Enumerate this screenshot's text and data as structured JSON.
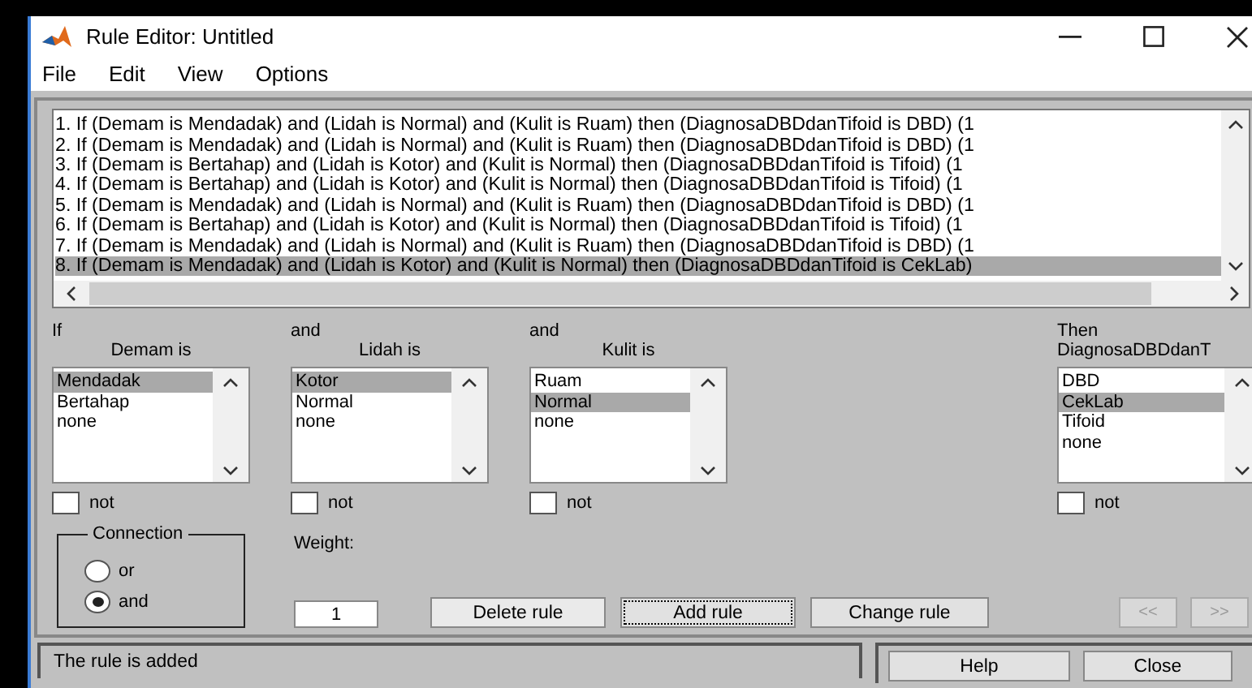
{
  "window": {
    "title": "Rule Editor: Untitled"
  },
  "menu": [
    "File",
    "Edit",
    "View",
    "Options"
  ],
  "rules": [
    {
      "text": "1. If (Demam is Mendadak) and (Lidah is Normal) and (Kulit is Ruam) then (DiagnosaDBDdanTifoid is DBD) (1",
      "selected": false
    },
    {
      "text": "2. If (Demam is Mendadak) and (Lidah is Normal) and (Kulit is Ruam) then (DiagnosaDBDdanTifoid is DBD) (1",
      "selected": false
    },
    {
      "text": "3. If (Demam is Bertahap) and (Lidah is Kotor) and (Kulit is Normal) then (DiagnosaDBDdanTifoid is Tifoid) (1",
      "selected": false
    },
    {
      "text": "4. If (Demam is Bertahap) and (Lidah is Kotor) and (Kulit is Normal) then (DiagnosaDBDdanTifoid is Tifoid) (1",
      "selected": false
    },
    {
      "text": "5. If (Demam is Mendadak) and (Lidah is Normal) and (Kulit is Ruam) then (DiagnosaDBDdanTifoid is DBD) (1",
      "selected": false
    },
    {
      "text": "6. If (Demam is Bertahap) and (Lidah is Kotor) and (Kulit is Normal) then (DiagnosaDBDdanTifoid is Tifoid) (1",
      "selected": false
    },
    {
      "text": "7. If (Demam is Mendadak) and (Lidah is Normal) and (Kulit is Ruam) then (DiagnosaDBDdanTifoid is DBD) (1",
      "selected": false
    },
    {
      "text": "8. If (Demam is Mendadak) and (Lidah is Kotor) and (Kulit is Normal) then (DiagnosaDBDdanTifoid is CekLab)",
      "selected": true
    }
  ],
  "variables": [
    {
      "kind": "input",
      "connector": "If",
      "label": "Demam is",
      "options": [
        {
          "label": "Mendadak",
          "selected": true
        },
        {
          "label": "Bertahap",
          "selected": false
        },
        {
          "label": "none",
          "selected": false
        }
      ],
      "not_label": "not",
      "not": false
    },
    {
      "kind": "input",
      "connector": "and",
      "label": "Lidah is",
      "options": [
        {
          "label": "Kotor",
          "selected": true
        },
        {
          "label": "Normal",
          "selected": false
        },
        {
          "label": "none",
          "selected": false
        }
      ],
      "not_label": "not",
      "not": false
    },
    {
      "kind": "input",
      "connector": "and",
      "label": "Kulit is",
      "options": [
        {
          "label": "Ruam",
          "selected": false
        },
        {
          "label": "Normal",
          "selected": true
        },
        {
          "label": "none",
          "selected": false
        }
      ],
      "not_label": "not",
      "not": false
    },
    {
      "kind": "output",
      "connector": "Then",
      "label": "DiagnosaDBDdanT",
      "options": [
        {
          "label": "DBD",
          "selected": false
        },
        {
          "label": "CekLab",
          "selected": true
        },
        {
          "label": "Tifoid",
          "selected": false
        },
        {
          "label": "none",
          "selected": false
        }
      ],
      "not_label": "not",
      "not": false
    }
  ],
  "connection": {
    "title": "Connection",
    "options": [
      {
        "label": "or",
        "selected": false
      },
      {
        "label": "and",
        "selected": true
      }
    ]
  },
  "weight": {
    "label": "Weight:",
    "value": "1"
  },
  "buttons": [
    {
      "label": "Delete rule",
      "focused": false
    },
    {
      "label": "Add rule",
      "focused": true
    },
    {
      "label": "Change rule",
      "focused": false
    }
  ],
  "nav": [
    {
      "label": "<<",
      "disabled": true
    },
    {
      "label": ">>",
      "disabled": true
    }
  ],
  "status": "The rule is added",
  "footer_buttons": [
    "Help",
    "Close"
  ]
}
